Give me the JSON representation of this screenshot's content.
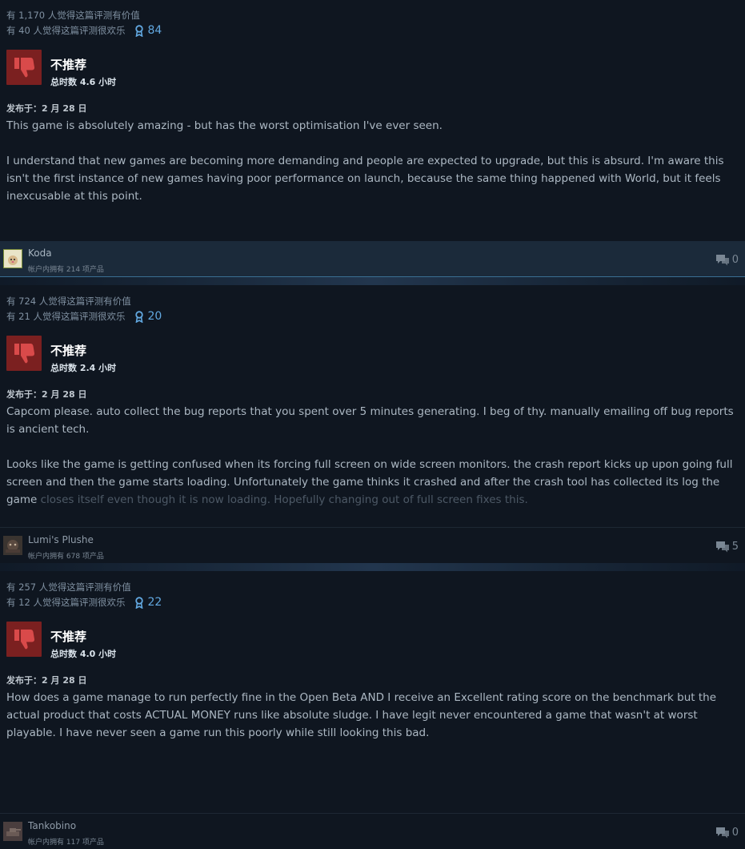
{
  "colors": {
    "background": "#0f1620",
    "thumb_bg": "#7b2020",
    "award": "#62a8e0",
    "highlight_bar": "#1b2a3a"
  },
  "reviews": [
    {
      "helpful": "有 1,170 人觉得这篇评测有价值",
      "funny": "有 40 人觉得这篇评测很欢乐",
      "awards": "84",
      "verdict": "不推荐",
      "hours": "总时数 4.6 小时",
      "posted": "发布于：2 月 28 日",
      "paragraphs": [
        "This game is absolutely amazing - but has the worst optimisation I've ever seen.",
        "I understand that new games are becoming more demanding and people are expected to upgrade, but this is absurd. I'm aware this isn't the first instance of new games having poor performance on launch, because the same thing happened with World, but it feels inexcusable at this point."
      ],
      "user": {
        "name": "Koda",
        "products": "帐户内拥有 214 项产品",
        "avatar": "avatar-dog"
      },
      "comments": "0"
    },
    {
      "helpful": "有 724 人觉得这篇评测有价值",
      "funny": "有 21 人觉得这篇评测很欢乐",
      "awards": "20",
      "verdict": "不推荐",
      "hours": "总时数 2.4 小时",
      "posted": "发布于：2 月 28 日",
      "paragraphs": [
        "Capcom please. auto collect the bug reports that you spent over 5 minutes generating. I beg of thy. manually emailing off bug reports is ancient tech.",
        "Looks like the game is getting confused when its forcing full screen on wide screen monitors. the crash report kicks up upon going full screen and then the game starts loading. Unfortunately the game thinks it crashed and after the crash tool has collected its log the game",
        "closes itself even though it is now loading. Hopefully changing out of full screen fixes this."
      ],
      "user": {
        "name": "Lumi's Plushe",
        "products": "帐户内拥有 678 项产品",
        "avatar": "avatar-plushie"
      },
      "comments": "5"
    },
    {
      "helpful": "有 257 人觉得这篇评测有价值",
      "funny": "有 12 人觉得这篇评测很欢乐",
      "awards": "22",
      "verdict": "不推荐",
      "hours": "总时数 4.0 小时",
      "posted": "发布于：2 月 28 日",
      "paragraphs": [
        "How does a game manage to run perfectly fine in the Open Beta AND I receive an Excellent rating score on the benchmark but the actual product that costs ACTUAL MONEY runs like absolute sludge. I have legit never encountered a game that wasn't at worst playable. I have never seen a game run this poorly while still looking this bad."
      ],
      "user": {
        "name": "Tankobino",
        "products": "帐户内拥有 117 项产品",
        "avatar": "avatar-tank"
      },
      "comments": "0"
    }
  ]
}
